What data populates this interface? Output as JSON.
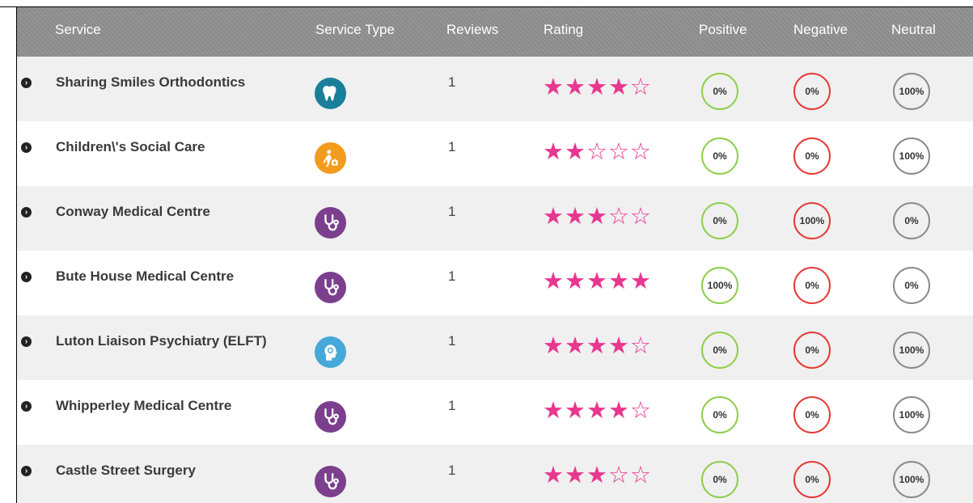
{
  "colors": {
    "header_bg": "#8f8f8f",
    "star": "#e8378f",
    "positive": "#8dce4a",
    "negative": "#e53935",
    "neutral": "#8a8a8a",
    "icon_dental": "#1a7f9a",
    "icon_social": "#f29b1d",
    "icon_medical": "#7b3f8e",
    "icon_mental": "#45a8d8"
  },
  "header": {
    "service": "Service",
    "service_type": "Service Type",
    "reviews": "Reviews",
    "rating": "Rating",
    "positive": "Positive",
    "negative": "Negative",
    "neutral": "Neutral"
  },
  "rows": [
    {
      "name": "Sharing Smiles Orthodontics",
      "type_icon": "tooth-icon",
      "reviews": "1",
      "rating": 4,
      "positive": "0%",
      "negative": "0%",
      "neutral": "100%"
    },
    {
      "name": "Children\\'s Social Care",
      "type_icon": "social-care-icon",
      "reviews": "1",
      "rating": 2,
      "positive": "0%",
      "negative": "0%",
      "neutral": "100%"
    },
    {
      "name": "Conway Medical Centre",
      "type_icon": "stethoscope-icon",
      "reviews": "1",
      "rating": 3,
      "positive": "0%",
      "negative": "100%",
      "neutral": "0%"
    },
    {
      "name": "Bute House Medical Centre",
      "type_icon": "stethoscope-icon",
      "reviews": "1",
      "rating": 5,
      "positive": "100%",
      "negative": "0%",
      "neutral": "0%"
    },
    {
      "name": "Luton Liaison Psychiatry (ELFT)",
      "type_icon": "mental-health-icon",
      "reviews": "1",
      "rating": 4,
      "positive": "0%",
      "negative": "0%",
      "neutral": "100%"
    },
    {
      "name": "Whipperley Medical Centre",
      "type_icon": "stethoscope-icon",
      "reviews": "1",
      "rating": 4,
      "positive": "0%",
      "negative": "0%",
      "neutral": "100%"
    },
    {
      "name": "Castle Street Surgery",
      "type_icon": "stethoscope-icon",
      "reviews": "1",
      "rating": 3,
      "positive": "0%",
      "negative": "0%",
      "neutral": "100%"
    }
  ]
}
